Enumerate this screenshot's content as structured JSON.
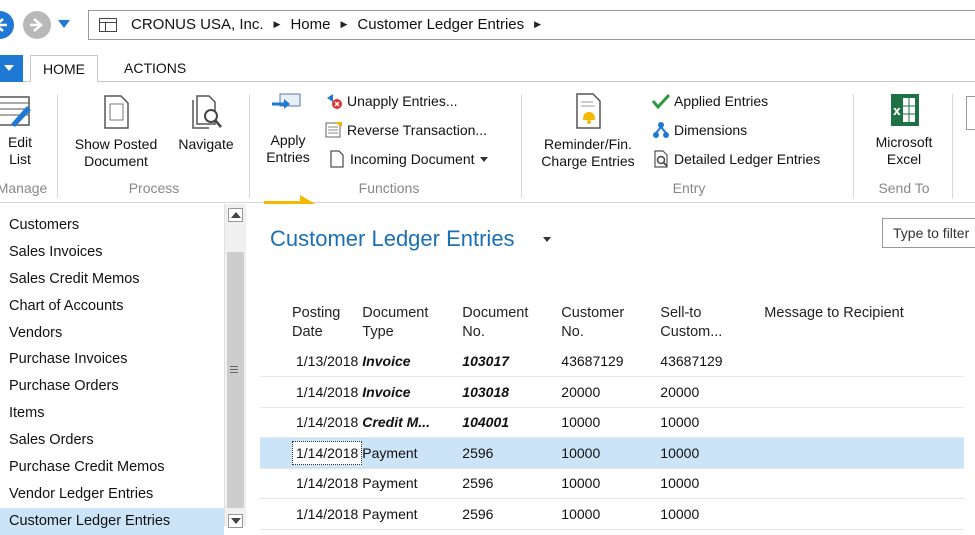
{
  "address": {
    "crumbs": [
      "CRONUS USA, Inc.",
      "Home",
      "Customer Ledger Entries"
    ]
  },
  "tabs": [
    {
      "label": "HOME"
    },
    {
      "label": "ACTIONS"
    }
  ],
  "ribbon": {
    "edit_list": "Edit List",
    "manage_label": "Manage",
    "show_posted_line1": "Show Posted",
    "show_posted_line2": "Document",
    "navigate": "Navigate",
    "process_label": "Process",
    "apply_line1": "Apply",
    "apply_line2": "Entries",
    "unapply": "Unapply Entries...",
    "reverse": "Reverse Transaction...",
    "incoming": "Incoming Document",
    "functions_label": "Functions",
    "reminder_line1": "Reminder/Fin.",
    "reminder_line2": "Charge Entries",
    "applied": "Applied Entries",
    "dimensions": "Dimensions",
    "detailed": "Detailed Ledger Entries",
    "entry_label": "Entry",
    "excel_line1": "Microsoft",
    "excel_line2": "Excel",
    "sendto_label": "Send To"
  },
  "nav": {
    "items": [
      "Customers",
      "Sales Invoices",
      "Sales Credit Memos",
      "Chart of Accounts",
      "Vendors",
      "Purchase Invoices",
      "Purchase Orders",
      "Items",
      "Sales Orders",
      "Purchase Credit Memos",
      "Vendor Ledger Entries",
      "Customer Ledger Entries"
    ],
    "selected_index": 11
  },
  "page": {
    "title": "Customer Ledger Entries",
    "filter_placeholder": "Type to filter"
  },
  "table": {
    "headers": {
      "posting_date": [
        "Posting",
        "Date"
      ],
      "document_type": [
        "Document",
        "Type"
      ],
      "document_no": [
        "Document",
        "No."
      ],
      "customer_no": [
        "Customer",
        "No."
      ],
      "sell_to": [
        "Sell-to",
        "Custom..."
      ],
      "message": [
        "Message to Recipient",
        ""
      ]
    },
    "rows": [
      {
        "date": "1/13/2018",
        "type": "Invoice",
        "docno": "103017",
        "cust": "43687129",
        "sell": "43687129",
        "highlight": true
      },
      {
        "date": "1/14/2018",
        "type": "Invoice",
        "docno": "103018",
        "cust": "20000",
        "sell": "20000",
        "highlight": true
      },
      {
        "date": "1/14/2018",
        "type": "Credit M...",
        "docno": "104001",
        "cust": "10000",
        "sell": "10000",
        "highlight": true
      },
      {
        "date": "1/14/2018",
        "type": "Payment",
        "docno": "2596",
        "cust": "10000",
        "sell": "10000",
        "highlight": false
      },
      {
        "date": "1/14/2018",
        "type": "Payment",
        "docno": "2596",
        "cust": "10000",
        "sell": "10000",
        "highlight": false
      },
      {
        "date": "1/14/2018",
        "type": "Payment",
        "docno": "2596",
        "cust": "10000",
        "sell": "10000",
        "highlight": false
      }
    ],
    "selected_row": 3
  },
  "colors": {
    "accent": "#1e79d4",
    "title": "#1a6fb5",
    "selection": "#cce4f7",
    "negative": "#c41a1a",
    "arrow": "#f5b800"
  }
}
